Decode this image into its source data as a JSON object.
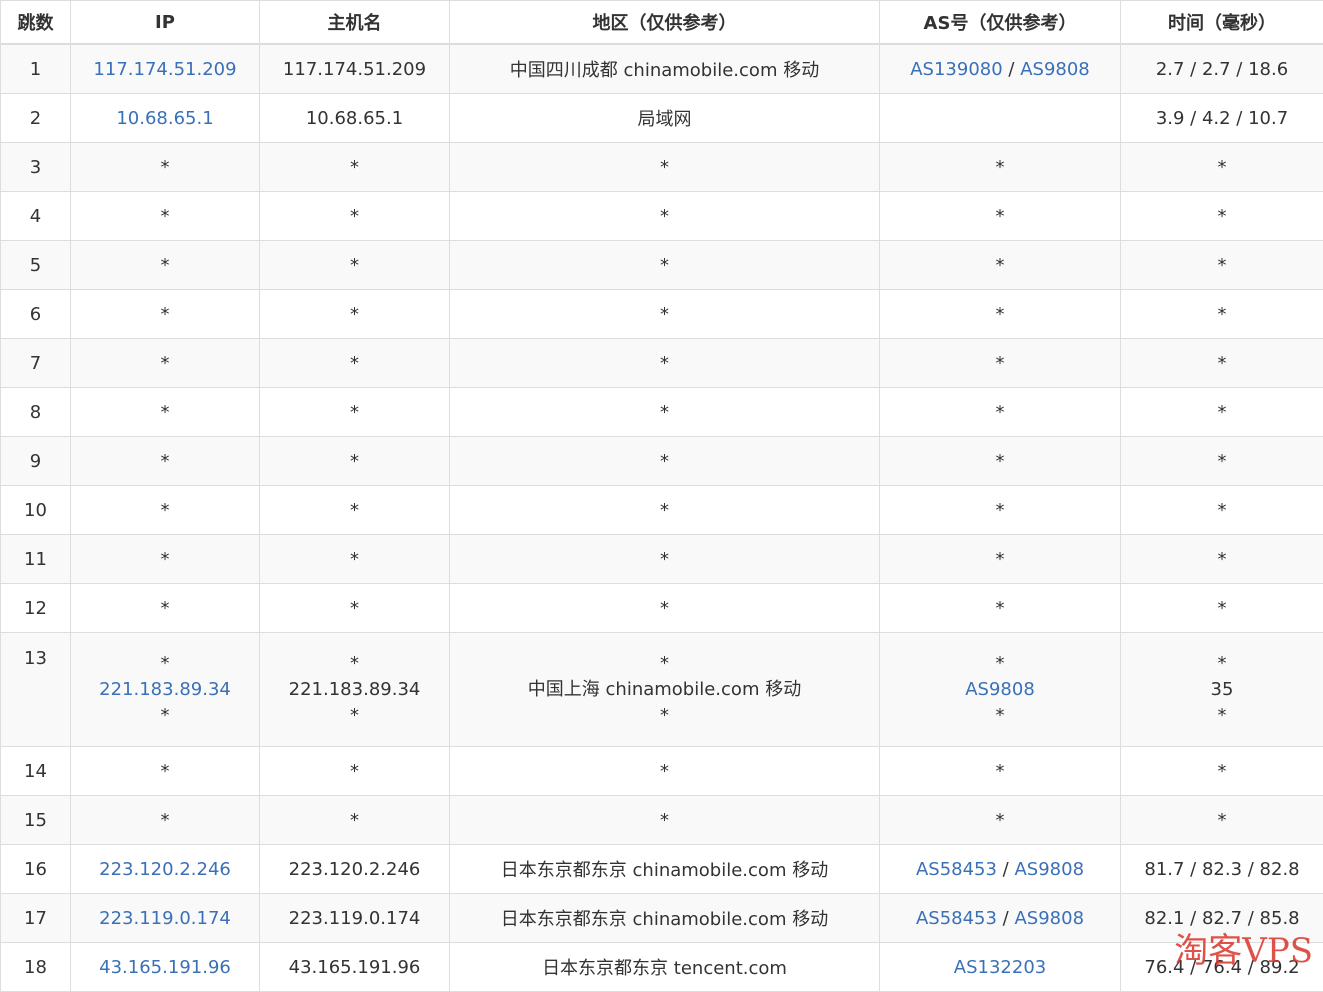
{
  "headers": [
    "跳数",
    "IP",
    "主机名",
    "地区（仅供参考）",
    "AS号（仅供参考）",
    "时间（毫秒）"
  ],
  "rows": [
    {
      "hop": "1",
      "ip": [
        "117.174.51.209"
      ],
      "host": [
        "117.174.51.209"
      ],
      "region": [
        "中国四川成都 chinamobile.com 移动"
      ],
      "as": [
        [
          "AS139080",
          "AS9808"
        ]
      ],
      "time": [
        "2.7 / 2.7 / 18.6"
      ]
    },
    {
      "hop": "2",
      "ip": [
        "10.68.65.1"
      ],
      "host": [
        "10.68.65.1"
      ],
      "region": [
        "局域网"
      ],
      "as": [
        []
      ],
      "time": [
        "3.9 / 4.2 / 10.7"
      ]
    },
    {
      "hop": "3",
      "ip": [
        "*"
      ],
      "host": [
        "*"
      ],
      "region": [
        "*"
      ],
      "as": [
        "*"
      ],
      "time": [
        "*"
      ]
    },
    {
      "hop": "4",
      "ip": [
        "*"
      ],
      "host": [
        "*"
      ],
      "region": [
        "*"
      ],
      "as": [
        "*"
      ],
      "time": [
        "*"
      ]
    },
    {
      "hop": "5",
      "ip": [
        "*"
      ],
      "host": [
        "*"
      ],
      "region": [
        "*"
      ],
      "as": [
        "*"
      ],
      "time": [
        "*"
      ]
    },
    {
      "hop": "6",
      "ip": [
        "*"
      ],
      "host": [
        "*"
      ],
      "region": [
        "*"
      ],
      "as": [
        "*"
      ],
      "time": [
        "*"
      ]
    },
    {
      "hop": "7",
      "ip": [
        "*"
      ],
      "host": [
        "*"
      ],
      "region": [
        "*"
      ],
      "as": [
        "*"
      ],
      "time": [
        "*"
      ]
    },
    {
      "hop": "8",
      "ip": [
        "*"
      ],
      "host": [
        "*"
      ],
      "region": [
        "*"
      ],
      "as": [
        "*"
      ],
      "time": [
        "*"
      ]
    },
    {
      "hop": "9",
      "ip": [
        "*"
      ],
      "host": [
        "*"
      ],
      "region": [
        "*"
      ],
      "as": [
        "*"
      ],
      "time": [
        "*"
      ]
    },
    {
      "hop": "10",
      "ip": [
        "*"
      ],
      "host": [
        "*"
      ],
      "region": [
        "*"
      ],
      "as": [
        "*"
      ],
      "time": [
        "*"
      ]
    },
    {
      "hop": "11",
      "ip": [
        "*"
      ],
      "host": [
        "*"
      ],
      "region": [
        "*"
      ],
      "as": [
        "*"
      ],
      "time": [
        "*"
      ]
    },
    {
      "hop": "12",
      "ip": [
        "*"
      ],
      "host": [
        "*"
      ],
      "region": [
        "*"
      ],
      "as": [
        "*"
      ],
      "time": [
        "*"
      ]
    },
    {
      "hop": "13",
      "ip": [
        "*",
        "221.183.89.34",
        "*"
      ],
      "host": [
        "*",
        "221.183.89.34",
        "*"
      ],
      "region": [
        "*",
        "中国上海 chinamobile.com 移动",
        "*"
      ],
      "as": [
        "*",
        [
          "AS9808"
        ],
        "*"
      ],
      "time": [
        "*",
        "35",
        "*"
      ]
    },
    {
      "hop": "14",
      "ip": [
        "*"
      ],
      "host": [
        "*"
      ],
      "region": [
        "*"
      ],
      "as": [
        "*"
      ],
      "time": [
        "*"
      ]
    },
    {
      "hop": "15",
      "ip": [
        "*"
      ],
      "host": [
        "*"
      ],
      "region": [
        "*"
      ],
      "as": [
        "*"
      ],
      "time": [
        "*"
      ]
    },
    {
      "hop": "16",
      "ip": [
        "223.120.2.246"
      ],
      "host": [
        "223.120.2.246"
      ],
      "region": [
        "日本东京都东京 chinamobile.com 移动"
      ],
      "as": [
        [
          "AS58453",
          "AS9808"
        ]
      ],
      "time": [
        "81.7 / 82.3 / 82.8"
      ]
    },
    {
      "hop": "17",
      "ip": [
        "223.119.0.174"
      ],
      "host": [
        "223.119.0.174"
      ],
      "region": [
        "日本东京都东京 chinamobile.com 移动"
      ],
      "as": [
        [
          "AS58453",
          "AS9808"
        ]
      ],
      "time": [
        "82.1 / 82.7 / 85.8"
      ]
    },
    {
      "hop": "18",
      "ip": [
        "43.165.191.96"
      ],
      "host": [
        "43.165.191.96"
      ],
      "region": [
        "日本东京都东京 tencent.com"
      ],
      "as": [
        [
          "AS132203"
        ]
      ],
      "time": [
        "76.4 / 76.4 / 89.2"
      ]
    }
  ],
  "watermark": "淘客VPS",
  "colors": {
    "link": "#3a70b8",
    "border": "#dddddd",
    "stripe": "#f9f9f9",
    "watermark": "#d9342b"
  }
}
